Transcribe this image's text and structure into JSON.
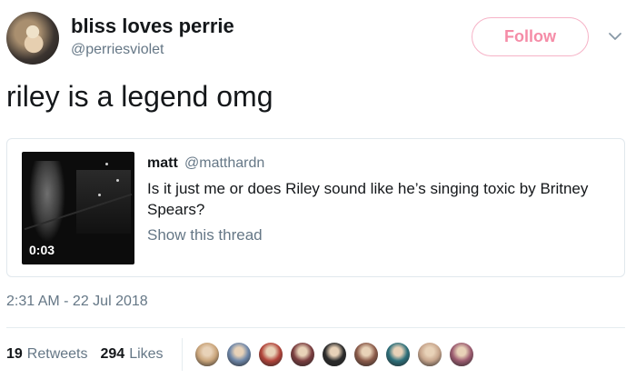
{
  "author": {
    "display_name": "bliss loves perrie",
    "handle": "@perriesviolet",
    "follow_label": "Follow"
  },
  "tweet": {
    "text": "riley is a legend omg",
    "timestamp": "2:31 AM - 22 Jul 2018"
  },
  "quoted": {
    "name": "matt",
    "handle": "@matthardn",
    "text": "Is it just me or does Riley sound like he’s singing toxic by Britney Spears?",
    "show_thread": "Show this thread",
    "video_duration": "0:03"
  },
  "stats": {
    "retweets_count": "19",
    "retweets_label": "Retweets",
    "likes_count": "294",
    "likes_label": "Likes"
  },
  "likers": [
    {
      "name": "liker-avatar",
      "color": "#c9a47a"
    },
    {
      "name": "liker-avatar",
      "color": "#6d86a8"
    },
    {
      "name": "liker-avatar",
      "color": "#b1443a"
    },
    {
      "name": "liker-avatar",
      "color": "#7a3d3f"
    },
    {
      "name": "liker-avatar",
      "color": "#2b2b2b"
    },
    {
      "name": "liker-avatar",
      "color": "#8b5b4a"
    },
    {
      "name": "liker-avatar",
      "color": "#2d6f7a"
    },
    {
      "name": "liker-avatar",
      "color": "#c7a58c"
    },
    {
      "name": "liker-avatar",
      "color": "#9c5c70"
    }
  ],
  "colors": {
    "accent": "#f58ca7",
    "muted": "#657786",
    "border": "#e1e8ed"
  }
}
